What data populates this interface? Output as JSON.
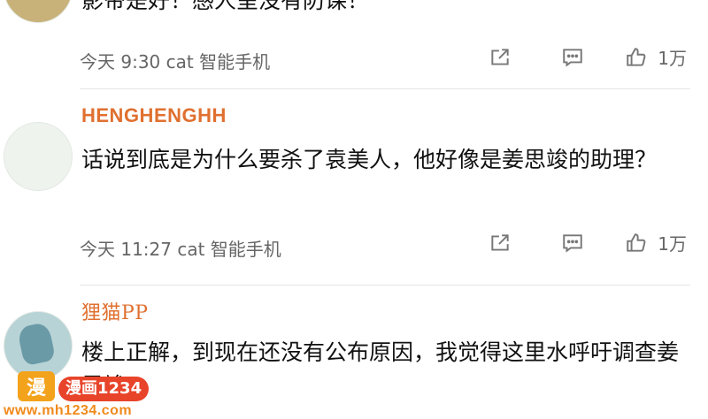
{
  "comments": [
    {
      "username": "",
      "text": "影帝是好！感人呈没有防课！",
      "time": "今天 9:30",
      "device": "cat 智能手机",
      "likes": "1万"
    },
    {
      "username": "HENGHENGHH",
      "text": "话说到底是为什么要杀了袁美人，他好像是姜思竣的助理？",
      "time": "今天 11:27",
      "device": "cat 智能手机",
      "likes": "1万"
    },
    {
      "username": "狸猫PP",
      "text": "楼上正解，到现在还没有公布原因，我觉得这里水呼吁调查姜思竣！",
      "time": "",
      "device": "",
      "likes": ""
    }
  ],
  "watermark": {
    "logo": "漫",
    "title": "漫画1234",
    "url": "www.mh1234.com"
  },
  "icons": {
    "share": "share-icon",
    "comment": "comment-icon",
    "like": "thumbs-up-icon"
  },
  "colors": {
    "username": "#e07030",
    "meta": "#666666",
    "icon": "#777777"
  }
}
